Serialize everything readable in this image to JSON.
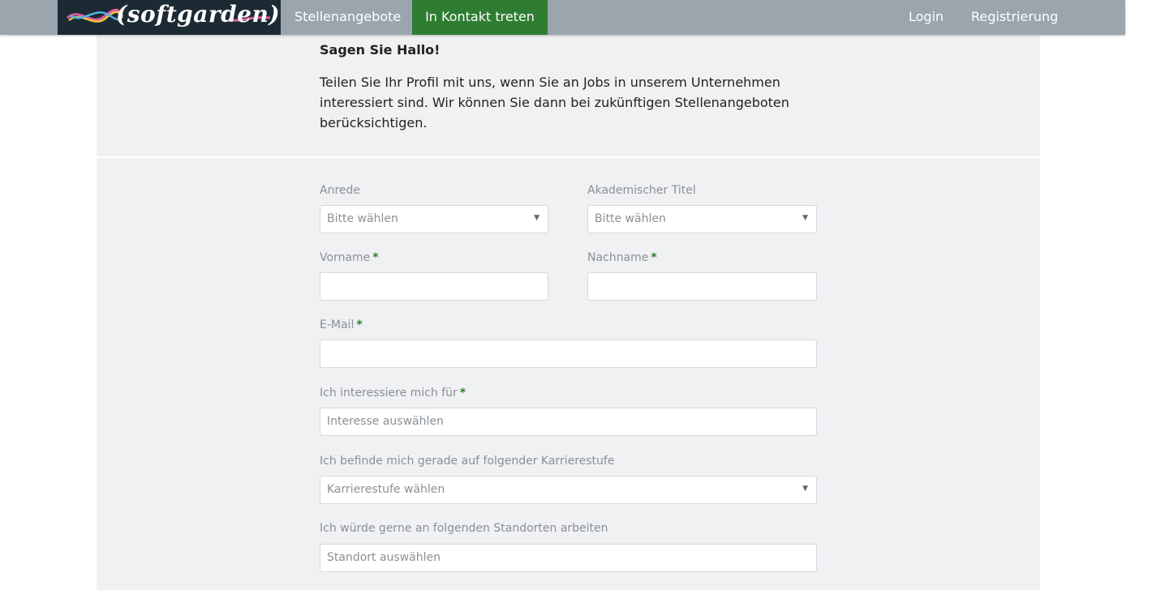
{
  "brand": {
    "logo_text": "(softgarden)"
  },
  "nav": {
    "jobs": "Stellenangebote",
    "contact": "In Kontakt treten",
    "login": "Login",
    "register": "Registrierung"
  },
  "intro": {
    "title": "Sagen Sie Hallo!",
    "text": "Teilen Sie Ihr Profil mit uns, wenn Sie an Jobs in unserem Unternehmen interessiert sind. Wir können Sie dann bei zukünftigen Stellenangeboten berücksichtigen."
  },
  "form": {
    "salutation": {
      "label": "Anrede",
      "value": "Bitte wählen"
    },
    "academic_title": {
      "label": "Akademischer Titel",
      "value": "Bitte wählen"
    },
    "first_name": {
      "label": "Vorname",
      "required_mark": "*",
      "value": ""
    },
    "last_name": {
      "label": "Nachname",
      "required_mark": "*",
      "value": ""
    },
    "email": {
      "label": "E-Mail",
      "required_mark": "*",
      "value": ""
    },
    "interest": {
      "label": "Ich interessiere mich für",
      "required_mark": "*",
      "placeholder": "Interesse auswählen"
    },
    "career_level": {
      "label": "Ich befinde mich gerade auf folgender Karrierestufe",
      "value": "Karrierestufe wählen"
    },
    "locations": {
      "label": "Ich würde gerne an folgenden Standorten arbeiten",
      "placeholder": "Standort auswählen"
    }
  },
  "icons": {
    "dropdown": "caret-down-icon"
  },
  "colors": {
    "nav_bg": "#9aa5ae",
    "brand_bg": "#1c2a33",
    "accent_green": "#2e7d32",
    "panel_bg": "#f0f1f3"
  }
}
